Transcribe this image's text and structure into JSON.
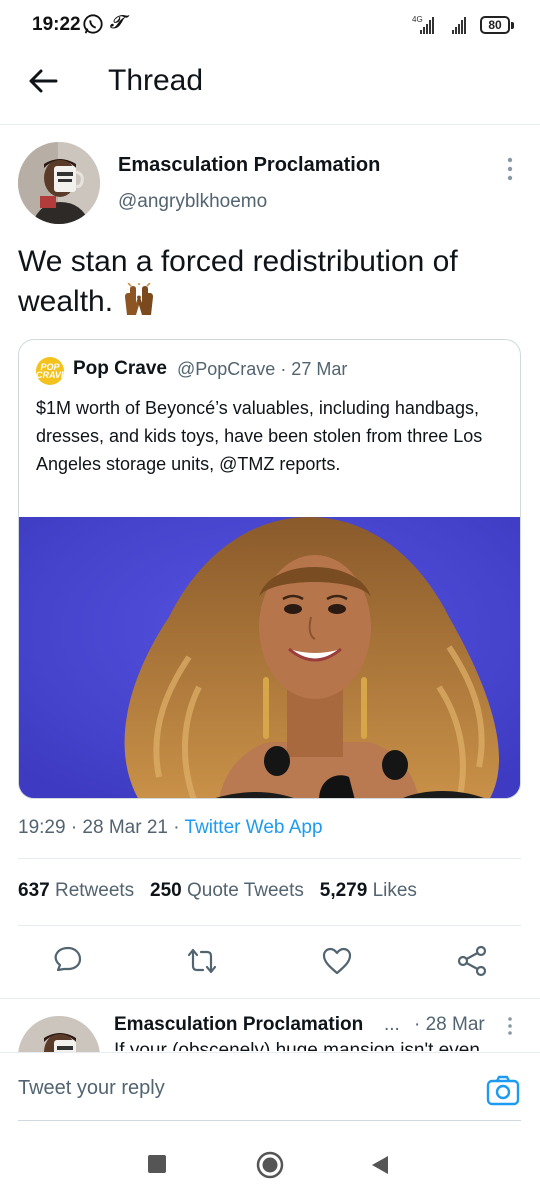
{
  "status_bar": {
    "time": "19:22",
    "network": "4G",
    "battery": "80",
    "icons": [
      "whatsapp-icon",
      "tumblr-icon",
      "signal-icon",
      "battery-icon"
    ]
  },
  "header": {
    "title": "Thread",
    "back_icon": "arrow-left-icon"
  },
  "tweet": {
    "author_name": "Emasculation Proclamation",
    "author_handle": "@angryblkhoemo",
    "text": "We stan a forced redistribution of wealth. ",
    "emoji": "raised-hands-emoji",
    "quote": {
      "name": "Pop Crave",
      "handle": "@PopCrave · 27 Mar",
      "avatar_text_1": "POP",
      "avatar_text_2": "CRAVE",
      "text": "$1M worth of Beyoncé’s valuables, including handbags, dresses, and kids toys, have been stolen from three Los Angeles storage units, @TMZ reports."
    },
    "time_date": "19:29 · 28 Mar 21 · ",
    "source": "Twitter Web App",
    "retweets_count": "637",
    "retweets_label": "Retweets",
    "quote_tweets_count": "250",
    "quote_tweets_label": "Quote Tweets",
    "likes_count": "5,279",
    "likes_label": "Likes"
  },
  "actions": [
    "reply-icon",
    "retweet-icon",
    "like-icon",
    "share-icon"
  ],
  "reply": {
    "author_name": "Emasculation Proclamation",
    "ellipsis": "...",
    "date": "· 28 Mar",
    "text": "If your (obscenely) huge mansion isn't even"
  },
  "reply_bar": {
    "placeholder": "Tweet your reply"
  },
  "colors": {
    "accent": "#1d9bf0",
    "text": "#0f1419",
    "secondary": "#536471",
    "image_bg": "#4a47d2"
  }
}
